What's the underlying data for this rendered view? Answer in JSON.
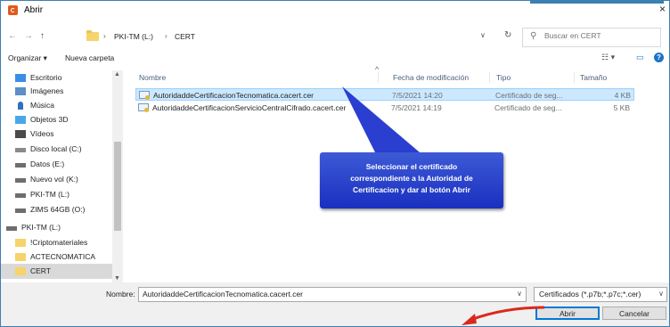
{
  "window": {
    "title": "Abrir",
    "close_label": "×"
  },
  "nav_buttons": {
    "back": "←",
    "forward": "→",
    "up": "↑"
  },
  "address": {
    "crumbs": [
      "PKI-TM (L:)",
      "CERT"
    ],
    "separator": "›",
    "chevron": "∨",
    "refresh": "↻"
  },
  "search": {
    "placeholder": "Buscar en CERT"
  },
  "toolbar": {
    "organize": "Organizar ▾",
    "new_folder": "Nueva carpeta",
    "view": "☷ ▾",
    "preview": "▭",
    "help": "?"
  },
  "sidebar": {
    "items": [
      {
        "label": "Escritorio",
        "icon": "desktop-icon",
        "color": "#3a8ee6"
      },
      {
        "label": "Imágenes",
        "icon": "pictures-icon",
        "color": "#5b8fc5"
      },
      {
        "label": "Música",
        "icon": "music-icon",
        "color": "#3070c0"
      },
      {
        "label": "Objetos 3D",
        "icon": "3d-objects-icon",
        "color": "#48a7e8"
      },
      {
        "label": "Vídeos",
        "icon": "videos-icon",
        "color": "#4a4a4a"
      },
      {
        "label": "Disco local (C:)",
        "icon": "drive-icon",
        "color": "#8a8a8a"
      },
      {
        "label": "Datos (E:)",
        "icon": "drive-icon",
        "color": "#6e6e6e"
      },
      {
        "label": "Nuevo vol (K:)",
        "icon": "drive-icon",
        "color": "#6e6e6e"
      },
      {
        "label": "PKI-TM (L:)",
        "icon": "drive-icon",
        "color": "#6e6e6e"
      },
      {
        "label": "ZIMS 64GB (O:)",
        "icon": "drive-icon",
        "color": "#6e6e6e"
      },
      {
        "label": "PKI-TM (L:)",
        "icon": "drive-icon",
        "color": "#6e6e6e"
      },
      {
        "label": "!Criptomateriales",
        "icon": "folder-icon",
        "color": "#f6d46b"
      },
      {
        "label": "ACTECNOMATICA",
        "icon": "folder-icon",
        "color": "#f6d46b"
      },
      {
        "label": "CERT",
        "icon": "folder-icon",
        "color": "#f6d46b",
        "selected": true
      }
    ]
  },
  "columns": {
    "name": "Nombre",
    "modified": "Fecha de modificación",
    "type": "Tipo",
    "size": "Tamaño",
    "sort_arrow": "^"
  },
  "files": [
    {
      "name": "AutoridaddeCertificacionTecnomatica.cacert.cer",
      "modified": "7/5/2021 14:20",
      "type": "Certificado de seg...",
      "size": "4 KB",
      "selected": true
    },
    {
      "name": "AutoridaddeCertificacionServicioCentralCifrado.cacert.cer",
      "modified": "7/5/2021 14:19",
      "type": "Certificado de seg...",
      "size": "5 KB",
      "selected": false
    }
  ],
  "bottom": {
    "name_label": "Nombre:",
    "name_value": "AutoridaddeCertificacionTecnomatica.cacert.cer",
    "filter": "Certificados (*.p7b;*.p7c;*.cer)",
    "open_button": "Abrir",
    "cancel_button": "Cancelar"
  },
  "callout": {
    "lines": [
      "Seleccionar el certificado",
      "correspondiente a la Autoridad de",
      "Certificacion y dar al botón Abrir"
    ],
    "color": "#2a3fd0"
  },
  "arrow_color": "#d9291c"
}
